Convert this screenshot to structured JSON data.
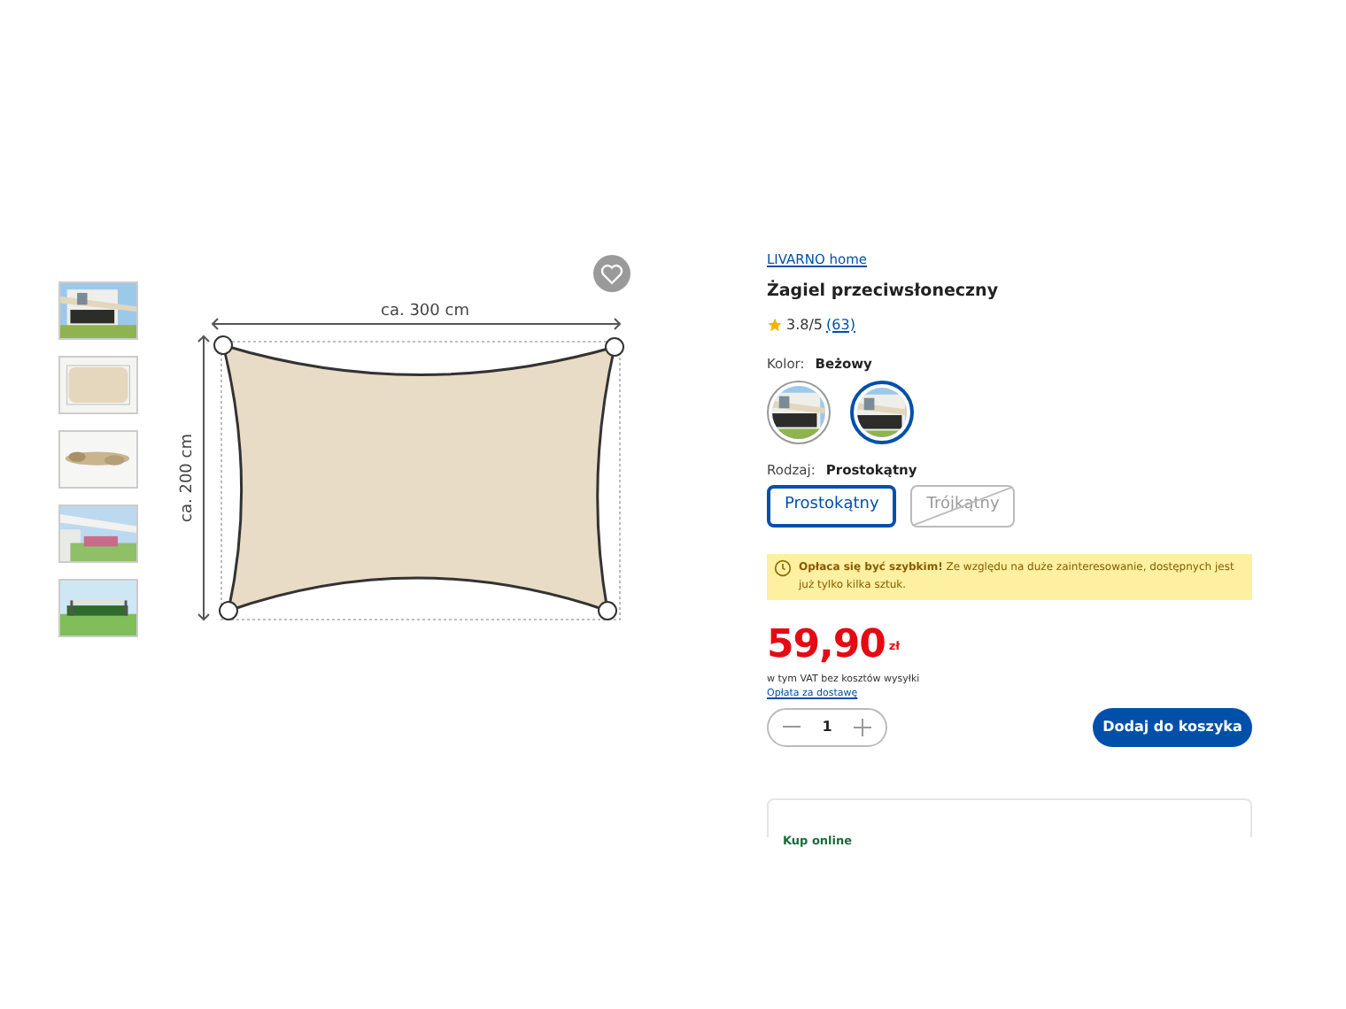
{
  "gallery": {
    "diagram": {
      "width_label": "ca. 300 cm",
      "height_label": "ca. 200 cm"
    },
    "favorite": {
      "selected": false
    }
  },
  "product": {
    "brand": "LIVARNO home",
    "title": "Żagiel przeciwsłoneczny",
    "rating": "3.8/5",
    "reviews": "(63)",
    "color": {
      "label": "Kolor:",
      "value": "Beżowy",
      "swatches": [
        {
          "selected": false
        },
        {
          "selected": true
        }
      ]
    },
    "type": {
      "label": "Rodzaj:",
      "value": "Prostokątny",
      "options": [
        {
          "label": "Prostokątny",
          "selected": true,
          "disabled": false
        },
        {
          "label": "Trójkątny",
          "selected": false,
          "disabled": true
        }
      ]
    },
    "notice": "**Opłaca się być szybkim!** Ze względu na duże zainteresowanie, dostępnych jest już tylko kilka sztuk.",
    "price": "59,90",
    "currency": "zł",
    "vat_note": "w tym VAT bez kosztów wysyłki",
    "shipping_link": "Opłata za dostawę",
    "quantity": "1",
    "add_button": "Dodaj do koszyka",
    "online_card": {
      "title": "Kup online"
    }
  }
}
